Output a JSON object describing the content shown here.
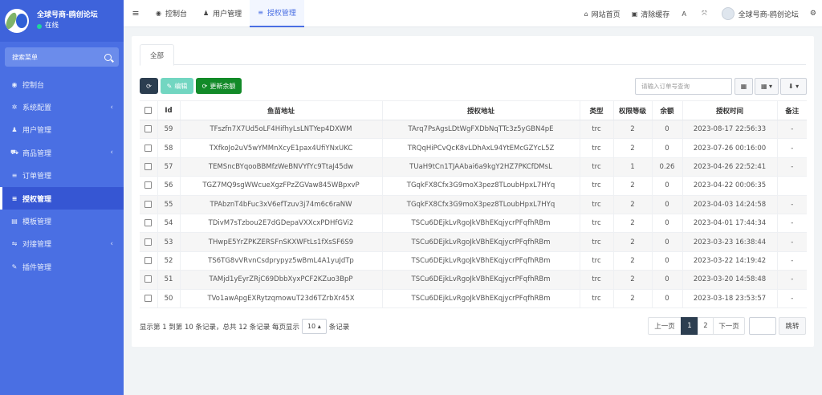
{
  "sidebar": {
    "site_name": "全球号商-鸥创论坛",
    "status": "在线",
    "search_label": "搜索菜单",
    "items": [
      {
        "icon": "◉",
        "label": "控制台",
        "chevron": false
      },
      {
        "icon": "✲",
        "label": "系统配置",
        "chevron": true
      },
      {
        "icon": "♟",
        "label": "用户管理",
        "chevron": false
      },
      {
        "icon": "⛟",
        "label": "商品管理",
        "chevron": true
      },
      {
        "icon": "≡",
        "label": "订单管理",
        "chevron": false
      },
      {
        "icon": "≡",
        "label": "授权管理",
        "chevron": false,
        "active": true
      },
      {
        "icon": "▤",
        "label": "模板管理",
        "chevron": false
      },
      {
        "icon": "⇋",
        "label": "对接管理",
        "chevron": true
      },
      {
        "icon": "✎",
        "label": "插件管理",
        "chevron": false
      }
    ],
    "chevron_glyph": "‹"
  },
  "topbar": {
    "toggle": "≡",
    "tabs": [
      {
        "icon": "◉",
        "label": "控制台"
      },
      {
        "icon": "♟",
        "label": "用户管理"
      },
      {
        "icon": "≡",
        "label": "授权管理",
        "active": true
      }
    ],
    "links": [
      {
        "icon": "⌂",
        "label": "网站首页"
      },
      {
        "icon": "▣",
        "label": "清除缓存"
      },
      {
        "icon": "Ａ",
        "label": ""
      },
      {
        "icon": "⤧",
        "label": ""
      }
    ],
    "user_name": "全球号商-鸥创论坛",
    "settings_icon": "⚙"
  },
  "panel": {
    "tab_all": "全部",
    "buttons": {
      "refresh": "⟳",
      "edit_icon": "✎",
      "edit": "编辑",
      "balance_icon": "⟳",
      "balance": "更新余额"
    },
    "search_placeholder": "请输入订单号查询",
    "tool_icons": {
      "grid1": "▦",
      "grid2": "▦ ▾",
      "export": "⬇ ▾"
    },
    "columns": [
      "",
      "Id",
      "鱼苗地址",
      "授权地址",
      "类型",
      "权限等级",
      "余额",
      "授权时间",
      "备注"
    ],
    "rows": [
      {
        "id": "59",
        "fish": "TFszfn7X7Ud5oLF4HifhyLsLNTYep4DXWM",
        "auth": "TArq7PsAgsLDtWgFXDbNqTTc3z5yGBN4pE",
        "type": "trc",
        "level": "2",
        "balance": "0",
        "time": "2023-08-17 22:56:33",
        "note": "-"
      },
      {
        "id": "58",
        "fish": "TXfkoJo2uV5wYMMnXcyE1pax4UfiYNxUKC",
        "auth": "TRQqHiPCvQcK8vLDhAxL94YtEMcGZYcL5Z",
        "type": "trc",
        "level": "2",
        "balance": "0",
        "time": "2023-07-26 00:16:00",
        "note": "-"
      },
      {
        "id": "57",
        "fish": "TEMSncBYqooBBMfzWeBNVYfYc9TtaJ45dw",
        "auth": "TUaH9tCn1TJAAbai6a9kgY2HZ7PKCfDMsL",
        "type": "trc",
        "level": "1",
        "balance": "0.26",
        "time": "2023-04-26 22:52:41",
        "note": "-"
      },
      {
        "id": "56",
        "fish": "TGZ7MQ9sgWWcueXgzFPzZGVaw845WBpxvP",
        "auth": "TGqkFX8Cfx3G9moX3pez8TLoubHpxL7HYq",
        "type": "trc",
        "level": "2",
        "balance": "0",
        "time": "2023-04-22 00:06:35",
        "note": ""
      },
      {
        "id": "55",
        "fish": "TPAbznT4bFuc3xV6efTzuv3j74m6c6raNW",
        "auth": "TGqkFX8Cfx3G9moX3pez8TLoubHpxL7HYq",
        "type": "trc",
        "level": "2",
        "balance": "0",
        "time": "2023-04-03 14:24:58",
        "note": "-"
      },
      {
        "id": "54",
        "fish": "TDivM7sTzbou2E7dGDepaVXXcxPDHfGVi2",
        "auth": "TSCu6DEjkLvRgoJkVBhEKqjycrPFqfhRBm",
        "type": "trc",
        "level": "2",
        "balance": "0",
        "time": "2023-04-01 17:44:34",
        "note": "-"
      },
      {
        "id": "53",
        "fish": "THwpE5YrZPKZERSFnSKXWFtLs1fXsSF6S9",
        "auth": "TSCu6DEjkLvRgoJkVBhEKqjycrPFqfhRBm",
        "type": "trc",
        "level": "2",
        "balance": "0",
        "time": "2023-03-23 16:38:44",
        "note": "-"
      },
      {
        "id": "52",
        "fish": "TS6TG8vVRvnCsdprypyz5wBmL4A1yuJdTp",
        "auth": "TSCu6DEjkLvRgoJkVBhEKqjycrPFqfhRBm",
        "type": "trc",
        "level": "2",
        "balance": "0",
        "time": "2023-03-22 14:19:42",
        "note": "-"
      },
      {
        "id": "51",
        "fish": "TAMjd1yEyrZRjC69DbbXyxPCF2KZuo3BpP",
        "auth": "TSCu6DEjkLvRgoJkVBhEKqjycrPFqfhRBm",
        "type": "trc",
        "level": "2",
        "balance": "0",
        "time": "2023-03-20 14:58:48",
        "note": "-"
      },
      {
        "id": "50",
        "fish": "TVo1awApgEXRytzqmowuT23d6TZrbXr45X",
        "auth": "TSCu6DEjkLvRgoJkVBhEKqjycrPFqfhRBm",
        "type": "trc",
        "level": "2",
        "balance": "0",
        "time": "2023-03-18 23:53:57",
        "note": "-"
      }
    ],
    "footer": {
      "info": "显示第 1 到第 10 条记录，总共 12 条记录 每页显示",
      "page_size": "10 ▴",
      "suffix": "条记录"
    },
    "pagination": {
      "prev": "上一页",
      "pages": [
        "1",
        "2"
      ],
      "current": "1",
      "next": "下一页",
      "jump": "跳转",
      "jump_value": ""
    }
  }
}
